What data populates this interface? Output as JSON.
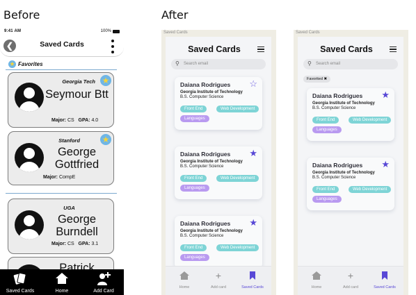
{
  "headings": {
    "before": "Before",
    "after": "After"
  },
  "before": {
    "status": {
      "left": "9:41 AM",
      "right": "100%"
    },
    "header": {
      "back_glyph": "❮",
      "title": "Saved Cards"
    },
    "favorites_label": "Favorites",
    "cards": [
      {
        "school": "Georgia Tech",
        "name": "Seymour Btt",
        "major_label": "Major:",
        "major": "CS",
        "gpa_label": "GPA:",
        "gpa": "4.0",
        "favorited": true
      },
      {
        "school": "Stanford",
        "name": "George Gottfried",
        "major_label": "Major:",
        "major": "CompE",
        "gpa_label": "",
        "gpa": "",
        "favorited": true
      },
      {
        "school": "UGA",
        "name": "George Burndell",
        "major_label": "Major:",
        "major": "CS",
        "gpa_label": "GPA:",
        "gpa": "3.1",
        "favorited": false
      },
      {
        "school": "",
        "name": "Patrick",
        "major_label": "",
        "major": "",
        "gpa_label": "",
        "gpa": "",
        "favorited": false
      }
    ],
    "tabs": [
      {
        "label": "Saved Cards",
        "icon": "cards-icon"
      },
      {
        "label": "Home",
        "icon": "home-icon"
      },
      {
        "label": "Add Card",
        "icon": "add-user-icon"
      }
    ]
  },
  "after": {
    "panels": [
      {
        "caption": "Saved Cards",
        "title": "Saved Cards",
        "search_placeholder": "Search email",
        "chip": "",
        "cards": [
          {
            "name": "Daiana Rodrigues",
            "school": "Georgia Institute of Technology",
            "degree": "B.S. Computer Science",
            "tags": [
              "Front End",
              "Web Development",
              "Languages"
            ],
            "starred": false
          },
          {
            "name": "Daiana Rodrigues",
            "school": "Georgia Institute of Technology",
            "degree": "B.S. Computer Science",
            "tags": [
              "Front End",
              "Web Development",
              "Languages"
            ],
            "starred": true
          },
          {
            "name": "Daiana Rodrigues",
            "school": "Georgia Institute of Technology",
            "degree": "B.S. Computer Science",
            "tags": [
              "Front End",
              "Web Development",
              "Languages"
            ],
            "starred": true
          }
        ],
        "nav": [
          {
            "label": "Home",
            "icon": "home-icon"
          },
          {
            "label": "Add card",
            "icon": "plus-icon"
          },
          {
            "label": "Saved Cards",
            "icon": "bookmark-icon"
          }
        ]
      },
      {
        "caption": "Saved Cards",
        "title": "Saved Cards",
        "search_placeholder": "Search email",
        "chip": "Favorited ✖",
        "cards": [
          {
            "name": "Daiana Rodrigues",
            "school": "Georgia Institute of Technology",
            "degree": "B.S. Computer Science",
            "tags": [
              "Front End",
              "Web Development",
              "Languages"
            ],
            "starred": true
          },
          {
            "name": "Daiana Rodrigues",
            "school": "Georgia Institute of Technology",
            "degree": "B.S. Computer Science",
            "tags": [
              "Front End",
              "Web Development",
              "Languages"
            ],
            "starred": true
          }
        ],
        "nav": [
          {
            "label": "Home",
            "icon": "home-icon"
          },
          {
            "label": "Add card",
            "icon": "plus-icon"
          },
          {
            "label": "Saved Cards",
            "icon": "bookmark-icon"
          }
        ]
      }
    ]
  },
  "colors": {
    "accent": "#5848d6",
    "teal_tag": "#7ed4d6",
    "purple_tag": "#b99af0",
    "favorite_badge": "#6fb6e6",
    "star_yellow": "#f5d33a"
  }
}
